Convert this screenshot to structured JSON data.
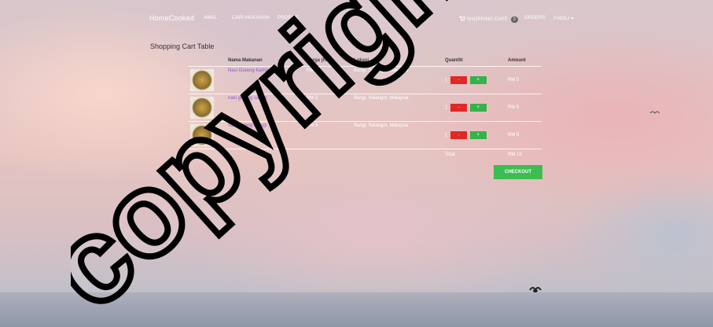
{
  "nav": {
    "brand": "HomeCooked",
    "links": [
      "AWAL",
      "CARI MAKANAN",
      "PROFILE"
    ],
    "cart_label": "SHOPPING CART",
    "cart_count": "3",
    "orders": "ORDERS",
    "user": "FADILI ▾"
  },
  "page_title": "Shopping Cart Table",
  "table": {
    "headers": [
      "Nama Makanan",
      "Harga (RM)",
      "Lokasi",
      "Quantiti",
      "Amount"
    ],
    "rows": [
      {
        "name": "Nasi Goreng Kampung",
        "price": "RM 5",
        "location": "Bangi, Selangor, Malaysia",
        "qty": "1",
        "amount": "RM 5"
      },
      {
        "name": "nasi goreng sardin",
        "price": "RM 5",
        "location": "Bangi, Selangor, Malaysia",
        "qty": "1",
        "amount": "RM 5"
      },
      {
        "name": "nasi goreng maggi",
        "price": "RM 5",
        "location": "Bangi, Selangor, Malaysia",
        "qty": "1",
        "amount": "RM 5"
      }
    ],
    "minus": "-",
    "plus": "+",
    "total_label": "Total",
    "total_value": "RM 15"
  },
  "checkout_label": "CHECKOUT",
  "watermark": "copyright©",
  "icons": {
    "cart": "shopping-cart-icon",
    "birds": "bird-icon"
  },
  "colors": {
    "minus": "#e02828",
    "plus": "#35b24a",
    "checkout": "#3dbd4f",
    "link": "#8e54c8"
  }
}
